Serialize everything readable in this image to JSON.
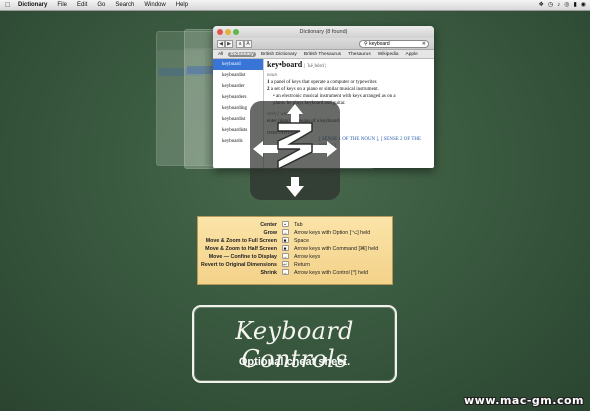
{
  "menubar": {
    "app": "Dictionary",
    "items": [
      "File",
      "Edit",
      "Go",
      "Search",
      "Window",
      "Help"
    ]
  },
  "window": {
    "title": "Dictionary (8 found)",
    "search_value": "keyboard",
    "tabs": [
      "All",
      "Dictionary",
      "British Dictionary",
      "British Thesaurus",
      "Thesaurus",
      "Wikipedia",
      "Apple"
    ],
    "active_tab": "Dictionary",
    "results": [
      "keyboard",
      "keyboardist",
      "keyboarder",
      "keyboarders",
      "keyboarding",
      "keyboardist",
      "keyboardists",
      "keyboards"
    ],
    "entry": {
      "headword": "key•board",
      "pronunciation": "| ˈkēˌbôrd |",
      "pos_noun": "noun",
      "def1": "a panel of keys that operate a computer or typewriter.",
      "def2": "a set of keys on a piano or similar musical instrument.",
      "def2_sub": "an electronic musical instrument with keys arranged as on a",
      "def2_sub2": "piano: he plays keyboard and guitar.",
      "pos_verb": "verb [ with obj. ]",
      "verb_def": "enter (data) by means of a keyboard.",
      "deriv": "DERIVATIVES",
      "link1": "[ SENSE 1 OF THE NOUN ],",
      "link2": "[ SENSE 2 OF THE NOUN ]"
    }
  },
  "shortcuts": [
    {
      "action": "Center",
      "icon": "•",
      "key": "Tab"
    },
    {
      "action": "Grow",
      "icon": "→",
      "key": "Arrow keys with Option [⌥] held"
    },
    {
      "action": "Move & Zoom to Full Screen",
      "icon": "■",
      "key": "Space"
    },
    {
      "action": "Move & Zoom to Half Screen",
      "icon": "■",
      "key": "Arrow keys with Command [⌘] held"
    },
    {
      "action": "Move — Confine to Display",
      "icon": "→",
      "key": "Arrow keys"
    },
    {
      "action": "Revert to Original Dimensions",
      "icon": "↩",
      "key": "Return"
    },
    {
      "action": "Shrink",
      "icon": "→",
      "key": "Arrow keys with Control [^] held"
    }
  ],
  "sign": {
    "title": "Keyboard Controls",
    "subtitle": "Optional cheat sheet."
  },
  "watermark": "www.mac-gm.com",
  "colors": {
    "chalkboard": "#3a5a40",
    "note": "#f7dc98",
    "selection": "#3875d7"
  }
}
